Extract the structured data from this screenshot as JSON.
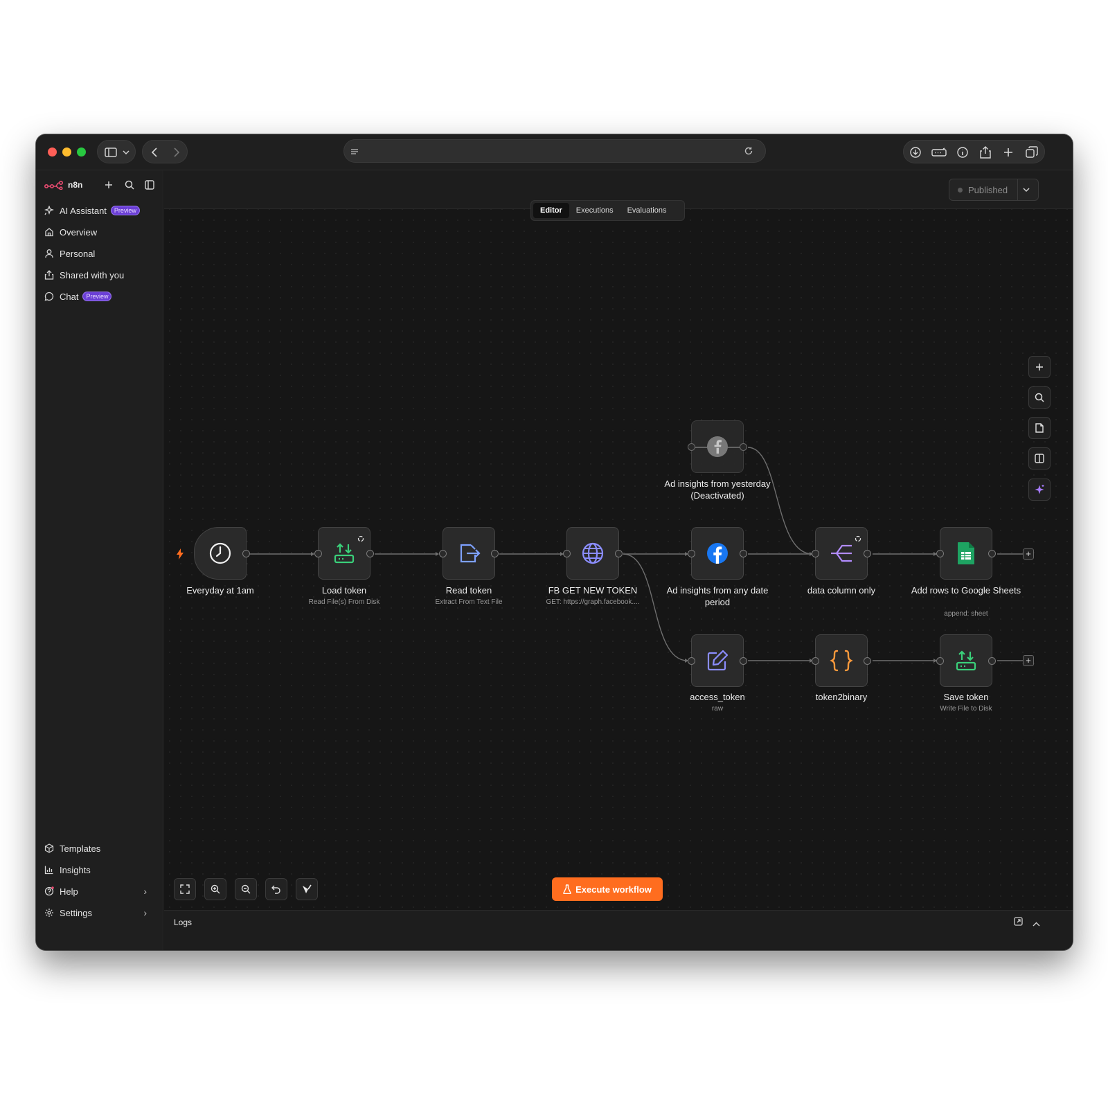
{
  "app": {
    "name": "n8n"
  },
  "colors": {
    "accent": "#ff6d1f",
    "brand": "#ea4b71",
    "preview": "#6b3fd6"
  },
  "sidebar": {
    "top_items": [
      {
        "label": "AI Assistant",
        "icon": "sparkle-icon",
        "badge": "Preview"
      },
      {
        "label": "Overview",
        "icon": "home-icon"
      },
      {
        "label": "Personal",
        "icon": "user-icon"
      },
      {
        "label": "Shared with you",
        "icon": "share-icon"
      },
      {
        "label": "Chat",
        "icon": "chat-icon",
        "badge": "Preview"
      }
    ],
    "bottom_items": [
      {
        "label": "Templates",
        "icon": "box-icon"
      },
      {
        "label": "Insights",
        "icon": "chart-icon"
      },
      {
        "label": "Help",
        "icon": "help-icon"
      },
      {
        "label": "Settings",
        "icon": "gear-icon"
      }
    ]
  },
  "header": {
    "status": "Published"
  },
  "tabs": [
    "Editor",
    "Executions",
    "Evaluations"
  ],
  "nodes": [
    {
      "id": "everyday",
      "name": "Everyday at 1am",
      "sub": ""
    },
    {
      "id": "load",
      "name": "Load token",
      "sub": "Read File(s) From Disk"
    },
    {
      "id": "read",
      "name": "Read token",
      "sub": "Extract From Text File"
    },
    {
      "id": "fbget",
      "name": "FB GET NEW TOKEN",
      "sub": "GET: https://graph.facebook...."
    },
    {
      "id": "adyest",
      "name": "Ad insights from yesterday (Deactivated)",
      "sub": ""
    },
    {
      "id": "adany",
      "name": "Ad insights from any date period",
      "sub": ""
    },
    {
      "id": "datacol",
      "name": "data column only",
      "sub": ""
    },
    {
      "id": "sheets",
      "name": "Add rows to Google Sheets",
      "sub": "append: sheet"
    },
    {
      "id": "access",
      "name": "access_token",
      "sub": "raw"
    },
    {
      "id": "t2b",
      "name": "token2binary",
      "sub": ""
    },
    {
      "id": "save",
      "name": "Save token",
      "sub": "Write File to Disk"
    }
  ],
  "actions": {
    "execute": "Execute workflow"
  },
  "logs": {
    "title": "Logs"
  }
}
